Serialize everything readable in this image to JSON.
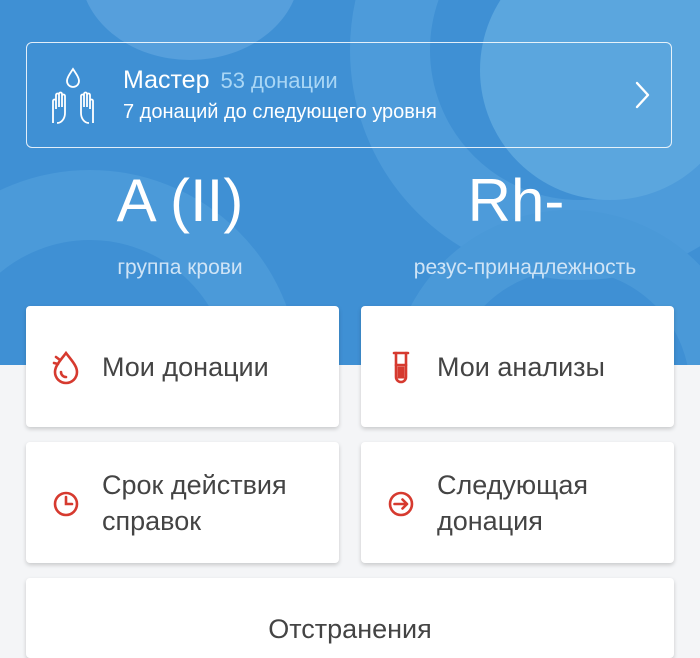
{
  "level": {
    "title": "Мастер",
    "count": "53 донации",
    "subtitle": "7 донаций до следующего уровня"
  },
  "blood": {
    "group_value": "A (II)",
    "group_label": "группа крови",
    "rh_value": "Rh-",
    "rh_label": "резус-принадлежность"
  },
  "tiles": [
    {
      "label": "Мои донации",
      "icon": "blood-drop-icon"
    },
    {
      "label": "Мои анализы",
      "icon": "test-tube-icon"
    },
    {
      "label": "Срок действия справок",
      "icon": "clock-icon"
    },
    {
      "label": "Следующая донация",
      "icon": "arrow-circle-icon"
    },
    {
      "label": "Отстранения",
      "icon": ""
    }
  ],
  "colors": {
    "accent": "#d63a2f",
    "header_blue": "#3f90d4"
  }
}
